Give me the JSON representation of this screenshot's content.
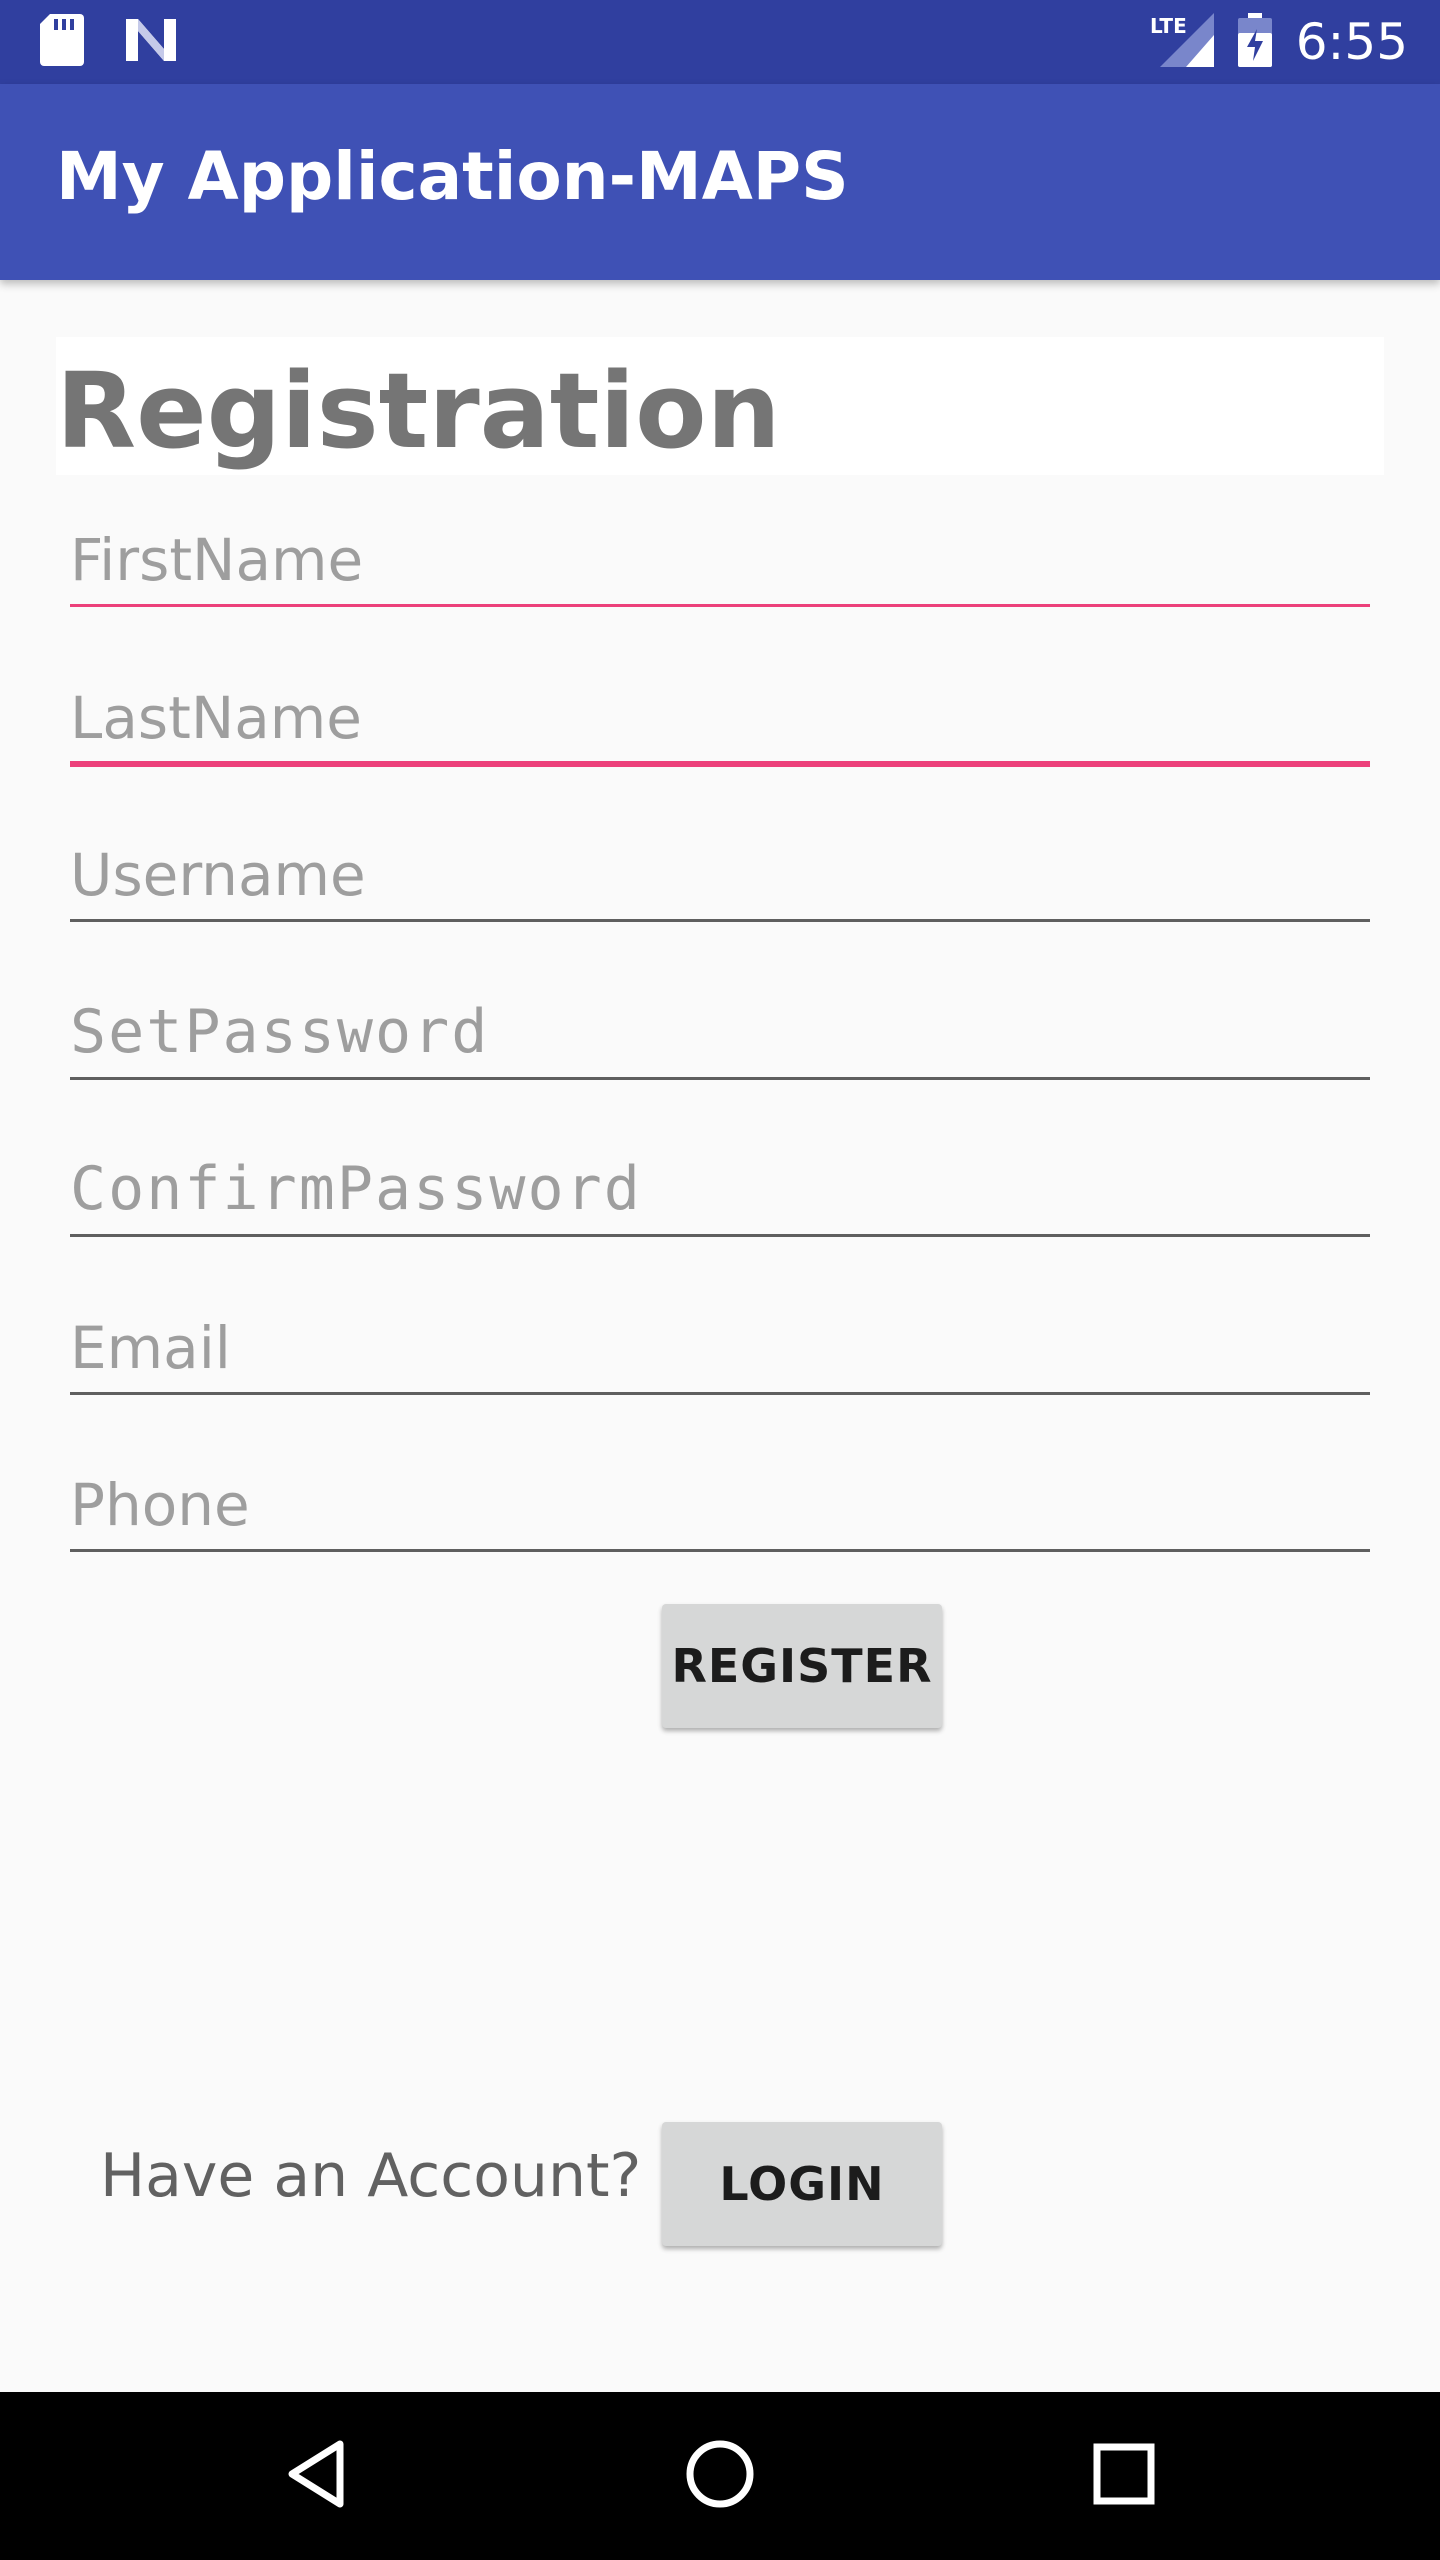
{
  "status_bar": {
    "time": "6:55",
    "network_label": "LTE",
    "icons": [
      "sd-card-icon",
      "n-notification-icon",
      "lte-signal-icon",
      "battery-charging-icon"
    ]
  },
  "app_bar": {
    "title": "My Application-MAPS",
    "color": "#3f51b5"
  },
  "form": {
    "heading": "Registration",
    "fields": {
      "first_name": {
        "placeholder": "FirstName"
      },
      "last_name": {
        "placeholder": "LastName"
      },
      "username": {
        "placeholder": "Username"
      },
      "set_password": {
        "placeholder": "SetPassword"
      },
      "confirm_password": {
        "placeholder": "ConfirmPassword"
      },
      "email": {
        "placeholder": "Email"
      },
      "phone": {
        "placeholder": "Phone"
      }
    },
    "register_label": "REGISTER",
    "accent_color": "#ec407a"
  },
  "footer": {
    "prompt": "Have an Account?",
    "login_label": "LOGIN"
  },
  "nav_bar": {
    "icons": [
      "back-icon",
      "home-icon",
      "recents-icon"
    ]
  }
}
